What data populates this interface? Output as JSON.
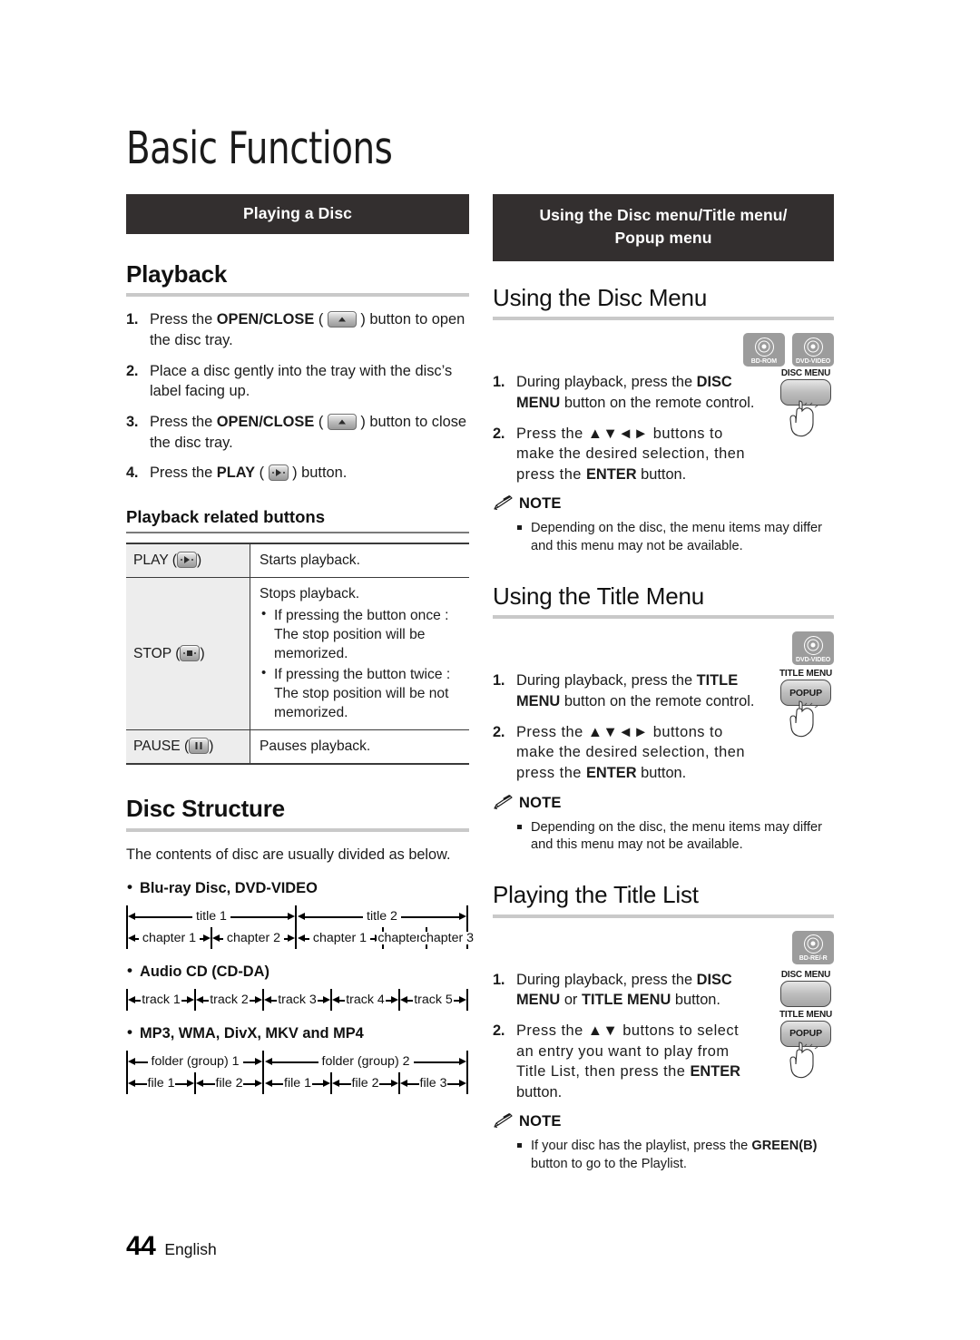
{
  "page": {
    "chapter_title": "Basic Functions",
    "page_number": "44",
    "language": "English"
  },
  "left_column": {
    "section_bar": "Playing a Disc",
    "playback": {
      "heading": "Playback",
      "steps": [
        {
          "num": "1.",
          "before": "Press the ",
          "bold": "OPEN/CLOSE",
          "icon": "eject-button-icon",
          "after": ") button to open the disc tray."
        },
        {
          "num": "2.",
          "before": "Place a disc gently into the tray with the disc’s label facing up.",
          "bold": "",
          "icon": "",
          "after": ""
        },
        {
          "num": "3.",
          "before": "Press the ",
          "bold": "OPEN/CLOSE",
          "icon": "eject-button-icon",
          "after": ") button to close the disc tray."
        },
        {
          "num": "4.",
          "before": "Press the ",
          "bold": "PLAY",
          "icon": "play-button-icon",
          "after": ") button."
        }
      ]
    },
    "related_buttons": {
      "subheading": "Playback related buttons",
      "rows": [
        {
          "key": "PLAY",
          "key_icon": "play-button-icon",
          "desc": "Starts playback.",
          "bullets": []
        },
        {
          "key": "STOP",
          "key_icon": "stop-button-icon",
          "desc": "Stops playback.",
          "bullets": [
            "If pressing the button once : The stop position will be memorized.",
            "If pressing the button twice : The stop position will be not memorized."
          ]
        },
        {
          "key": "PAUSE",
          "key_icon": "pause-button-icon",
          "desc": "Pauses playback.",
          "bullets": []
        }
      ]
    },
    "disc_structure": {
      "heading": "Disc Structure",
      "intro": "The contents of disc are usually divided as below.",
      "groups": [
        {
          "label": "Blu-ray Disc, DVD-VIDEO",
          "top_row": [
            "title 1",
            "title 2"
          ],
          "bottom_row": [
            "chapter 1",
            "chapter 2",
            "chapter 1",
            "chapter 2",
            "chapter 3"
          ]
        },
        {
          "label": "Audio CD (CD-DA)",
          "top_row": [],
          "bottom_row": [
            "track 1",
            "track 2",
            "track 3",
            "track 4",
            "track 5"
          ]
        },
        {
          "label": "MP3, WMA, DivX, MKV and MP4",
          "top_row": [
            "folder (group) 1",
            "folder (group) 2"
          ],
          "bottom_row": [
            "file 1",
            "file 2",
            "file 1",
            "file 2",
            "file 3"
          ]
        }
      ]
    }
  },
  "right_column": {
    "section_bar_line1": "Using the Disc menu/Title menu/",
    "section_bar_line2": "Popup menu",
    "disc_menu": {
      "heading": "Using the Disc Menu",
      "media_icons": [
        "BD-ROM",
        "DVD-VIDEO"
      ],
      "remote_button": {
        "caption": "DISC MENU",
        "key_label": ""
      },
      "steps": [
        {
          "num": "1.",
          "p1": "During playback, press the ",
          "b1": "DISC MENU",
          "p2": " button on the remote control.",
          "b2": "",
          "p3": ""
        },
        {
          "num": "2.",
          "p1": "Press the ▲▼◄► buttons to make the desired selection, then press the ",
          "b1": "ENTER",
          "p2": " button.",
          "b2": "",
          "p3": ""
        }
      ],
      "note_label": "NOTE",
      "notes": [
        {
          "p1": "Depending on the disc, the menu items may differ and this menu may not be available.",
          "b1": "",
          "p2": ""
        }
      ]
    },
    "title_menu": {
      "heading": "Using the Title Menu",
      "media_icons": [
        "DVD-VIDEO"
      ],
      "remote_button": {
        "caption": "TITLE MENU",
        "key_label": "POPUP"
      },
      "steps": [
        {
          "num": "1.",
          "p1": "During playback, press the ",
          "b1": "TITLE MENU",
          "p2": " button on the remote control.",
          "b2": "",
          "p3": ""
        },
        {
          "num": "2.",
          "p1": "Press the ▲▼◄► buttons to make the desired selection, then press the ",
          "b1": "ENTER",
          "p2": " button.",
          "b2": "",
          "p3": ""
        }
      ],
      "note_label": "NOTE",
      "notes": [
        {
          "p1": "Depending on the disc, the menu items may differ and this menu may not be available.",
          "b1": "",
          "p2": ""
        }
      ]
    },
    "title_list": {
      "heading": "Playing the Title List",
      "media_icons": [
        "BD-RE/-R"
      ],
      "remote_button_top": {
        "caption": "DISC MENU",
        "key_label": ""
      },
      "remote_button_bottom": {
        "caption": "TITLE MENU",
        "key_label": "POPUP"
      },
      "steps": [
        {
          "num": "1.",
          "p1": "During playback, press the ",
          "b1": "DISC MENU",
          "p2": " or ",
          "b2": "TITLE MENU",
          "p3": " button."
        },
        {
          "num": "2.",
          "p1": "Press the ▲▼ buttons to select an entry you want to play from Title List, then press the ",
          "b1": "ENTER",
          "p2": " button.",
          "b2": "",
          "p3": ""
        }
      ],
      "note_label": "NOTE",
      "notes": [
        {
          "p1": "If your disc has the playlist, press the ",
          "b1": "GREEN(B)",
          "p2": " button to go to the Playlist."
        }
      ]
    }
  },
  "colors": {
    "section_bar_bg": "#332f2f",
    "rule_gray": "#c9c9c9",
    "media_icon_bg": "#9c9c9c",
    "table_key_bg": "#ededed"
  }
}
